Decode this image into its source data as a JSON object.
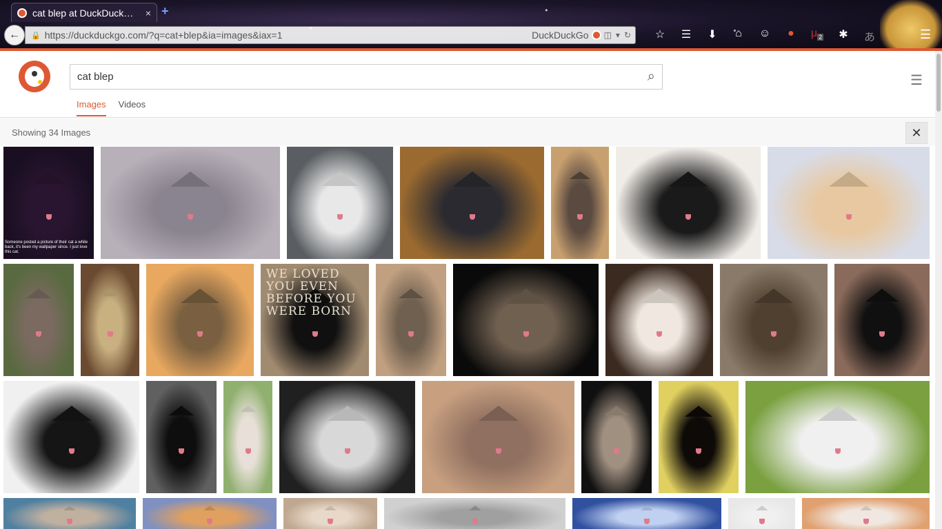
{
  "browser": {
    "tab_title": "cat blep at DuckDuck…",
    "tab_close": "×",
    "new_tab": "+",
    "url": "https://duckduckgo.com/?q=cat+blep&ia=images&iax=1",
    "search_engine": "DuckDuckGo",
    "toolbar_badge": "2"
  },
  "page": {
    "search_query": "cat blep",
    "tabs": [
      {
        "label": "Images",
        "active": true
      },
      {
        "label": "Videos",
        "active": false
      }
    ],
    "results_count": "Showing 34 Images",
    "close_label": "✕"
  },
  "images": [
    {
      "row": 1,
      "index": 1,
      "caption": "Someone posted a picture of their cat a while back, it's been my wallpaper since. I just love this cat.",
      "colors": [
        "#1a0f22",
        "#2a1530"
      ]
    },
    {
      "row": 1,
      "index": 2,
      "colors": [
        "#b8b0b8",
        "#8a8490"
      ]
    },
    {
      "row": 1,
      "index": 3,
      "colors": [
        "#5a5e62",
        "#e8e8e8"
      ]
    },
    {
      "row": 1,
      "index": 4,
      "colors": [
        "#9a6a30",
        "#2a2a30"
      ]
    },
    {
      "row": 1,
      "index": 5,
      "colors": [
        "#c8a070",
        "#5a4a40"
      ]
    },
    {
      "row": 1,
      "index": 6,
      "colors": [
        "#f0ece8",
        "#1a1a1a"
      ]
    },
    {
      "row": 1,
      "index": 7,
      "colors": [
        "#d8dce8",
        "#e8c8a0"
      ]
    },
    {
      "row": 2,
      "index": 8,
      "colors": [
        "#5a6a40",
        "#7a6a60"
      ]
    },
    {
      "row": 2,
      "index": 9,
      "colors": [
        "#6a4a30",
        "#c8b080"
      ]
    },
    {
      "row": 2,
      "index": 10,
      "colors": [
        "#e8a860",
        "#7a6040"
      ]
    },
    {
      "row": 2,
      "index": 11,
      "overlay_text": "WE LOVED YOU EVEN BEFORE YOU WERE BORN",
      "colors": [
        "#a08a70",
        "#101010"
      ]
    },
    {
      "row": 2,
      "index": 12,
      "colors": [
        "#c0a080",
        "#706050"
      ]
    },
    {
      "row": 2,
      "index": 13,
      "colors": [
        "#0a0a0a",
        "#706050"
      ]
    },
    {
      "row": 2,
      "index": 14,
      "colors": [
        "#3a2a20",
        "#f0e8e0"
      ]
    },
    {
      "row": 2,
      "index": 15,
      "colors": [
        "#8a7a6a",
        "#504030"
      ]
    },
    {
      "row": 2,
      "index": 16,
      "colors": [
        "#8a6a5a",
        "#101010"
      ]
    },
    {
      "row": 3,
      "index": 17,
      "colors": [
        "#f0f0f0",
        "#151515"
      ]
    },
    {
      "row": 3,
      "index": 18,
      "colors": [
        "#606060",
        "#0e0e0e"
      ]
    },
    {
      "row": 3,
      "index": 19,
      "colors": [
        "#90b070",
        "#e8e0d8"
      ]
    },
    {
      "row": 3,
      "index": 20,
      "colors": [
        "#202020",
        "#d8d8d8"
      ]
    },
    {
      "row": 3,
      "index": 21,
      "colors": [
        "#c8a080",
        "#907060"
      ]
    },
    {
      "row": 3,
      "index": 22,
      "colors": [
        "#101010",
        "#a09080"
      ]
    },
    {
      "row": 3,
      "index": 23,
      "colors": [
        "#e0d060",
        "#0e0a08"
      ]
    },
    {
      "row": 3,
      "index": 24,
      "colors": [
        "#7aa040",
        "#f0f0f0"
      ]
    },
    {
      "row": 4,
      "index": 25,
      "colors": [
        "#5080a0",
        "#c0b0a0"
      ]
    },
    {
      "row": 4,
      "index": 26,
      "colors": [
        "#8090c0",
        "#e0a060"
      ]
    },
    {
      "row": 4,
      "index": 27,
      "colors": [
        "#c0a890",
        "#e8d8c8"
      ]
    },
    {
      "row": 4,
      "index": 28,
      "colors": [
        "#d0d0d0",
        "#a0a0a0"
      ]
    },
    {
      "row": 4,
      "index": 29,
      "colors": [
        "#3050a0",
        "#c0d0f0"
      ]
    },
    {
      "row": 4,
      "index": 30,
      "colors": [
        "#e8e8e8",
        "#f0f0f0"
      ]
    },
    {
      "row": 4,
      "index": 31,
      "colors": [
        "#e0a070",
        "#f0e8e0"
      ]
    }
  ]
}
